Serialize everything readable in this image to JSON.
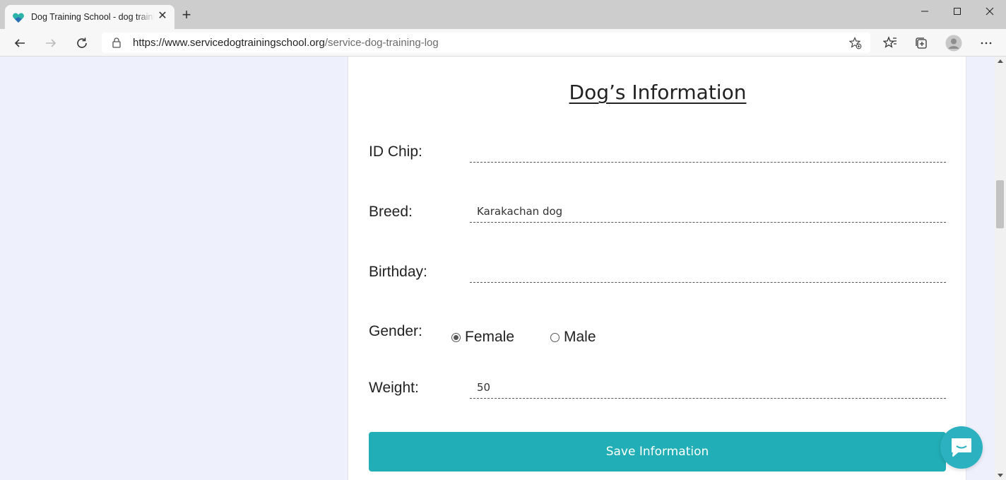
{
  "browser": {
    "tab_title": "Dog Training School - dog training log",
    "url_domain": "https://www.servicedogtrainingschool.org",
    "url_path": "/service-dog-training-log",
    "icons": [
      "heart-favicon-icon",
      "close-icon",
      "plus-icon",
      "back-arrow-icon",
      "forward-arrow-icon",
      "refresh-icon",
      "lock-icon",
      "star-add-icon",
      "favorites-icon",
      "collections-icon",
      "profile-icon",
      "more-icon"
    ]
  },
  "page": {
    "heading": "Dog’s Information",
    "id_chip": {
      "label": "ID Chip:",
      "value": ""
    },
    "breed": {
      "label": "Breed:",
      "value": "Karakachan dog"
    },
    "birthday": {
      "label": "Birthday:",
      "value": ""
    },
    "gender": {
      "label": "Gender:",
      "options": [
        "Female",
        "Male"
      ],
      "selected": "Female"
    },
    "weight": {
      "label": "Weight:",
      "value": "50"
    },
    "save_label": "Save Information"
  },
  "colors": {
    "accent": "#22aeb6",
    "page_background": "#eef0fc",
    "chat_button": "#2cb1c1"
  }
}
